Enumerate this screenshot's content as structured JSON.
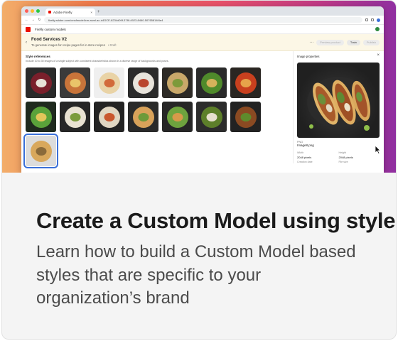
{
  "browser": {
    "tab_title": "Adobe Firefly",
    "tab_close": "×",
    "tab_new": "+",
    "url": "firefly.adobe.com/cmsfmodel/cm-asml-ac-d4GCE-8234d09f-378f-4923-8460-50765814f4e4"
  },
  "app": {
    "breadcrumb": "Firefly custom models"
  },
  "model": {
    "back": "‹",
    "title": "Food Services V2",
    "subtitle": "To generate images for recipe pages for in-store recipes",
    "status": "• Draft",
    "more": "···",
    "buttons": {
      "preview": "Preview product",
      "train": "Train",
      "publish": "Publish"
    }
  },
  "styles": {
    "title": "Style references",
    "description": "Include 10 to 30 images of a single subject with consistent characteristics shown in a diverse range of backgrounds and poses.",
    "thumbnails": [
      "bowl-dark",
      "pizza",
      "plate-salad",
      "meat-plate",
      "grain-bowls",
      "greens-spread",
      "tomato-soup",
      "green-salad",
      "stew-bowl",
      "veg-bowl",
      "grilled-chicken",
      "grilled-salad",
      "green-soup",
      "skewers",
      "tacos"
    ],
    "selected_index": 14
  },
  "properties": {
    "title": "Image properties",
    "close": "×",
    "file_type": "PNG",
    "file_name": "Image8.png",
    "width_label": "Width",
    "width_value": "2048 pixels",
    "height_label": "Height",
    "height_value": "2048 pixels",
    "creation_label": "Creation date",
    "size_label": "File size"
  },
  "caption": {
    "headline": "Create a Custom Model using styles",
    "body": "Learn how to build a Custom Model based styles that are specific to your organization’s brand"
  },
  "colors": {
    "adobe_red": "#eb1000",
    "headline": "#1b1b1b",
    "body": "#4b4b4b",
    "selection": "#3a6fd8"
  }
}
